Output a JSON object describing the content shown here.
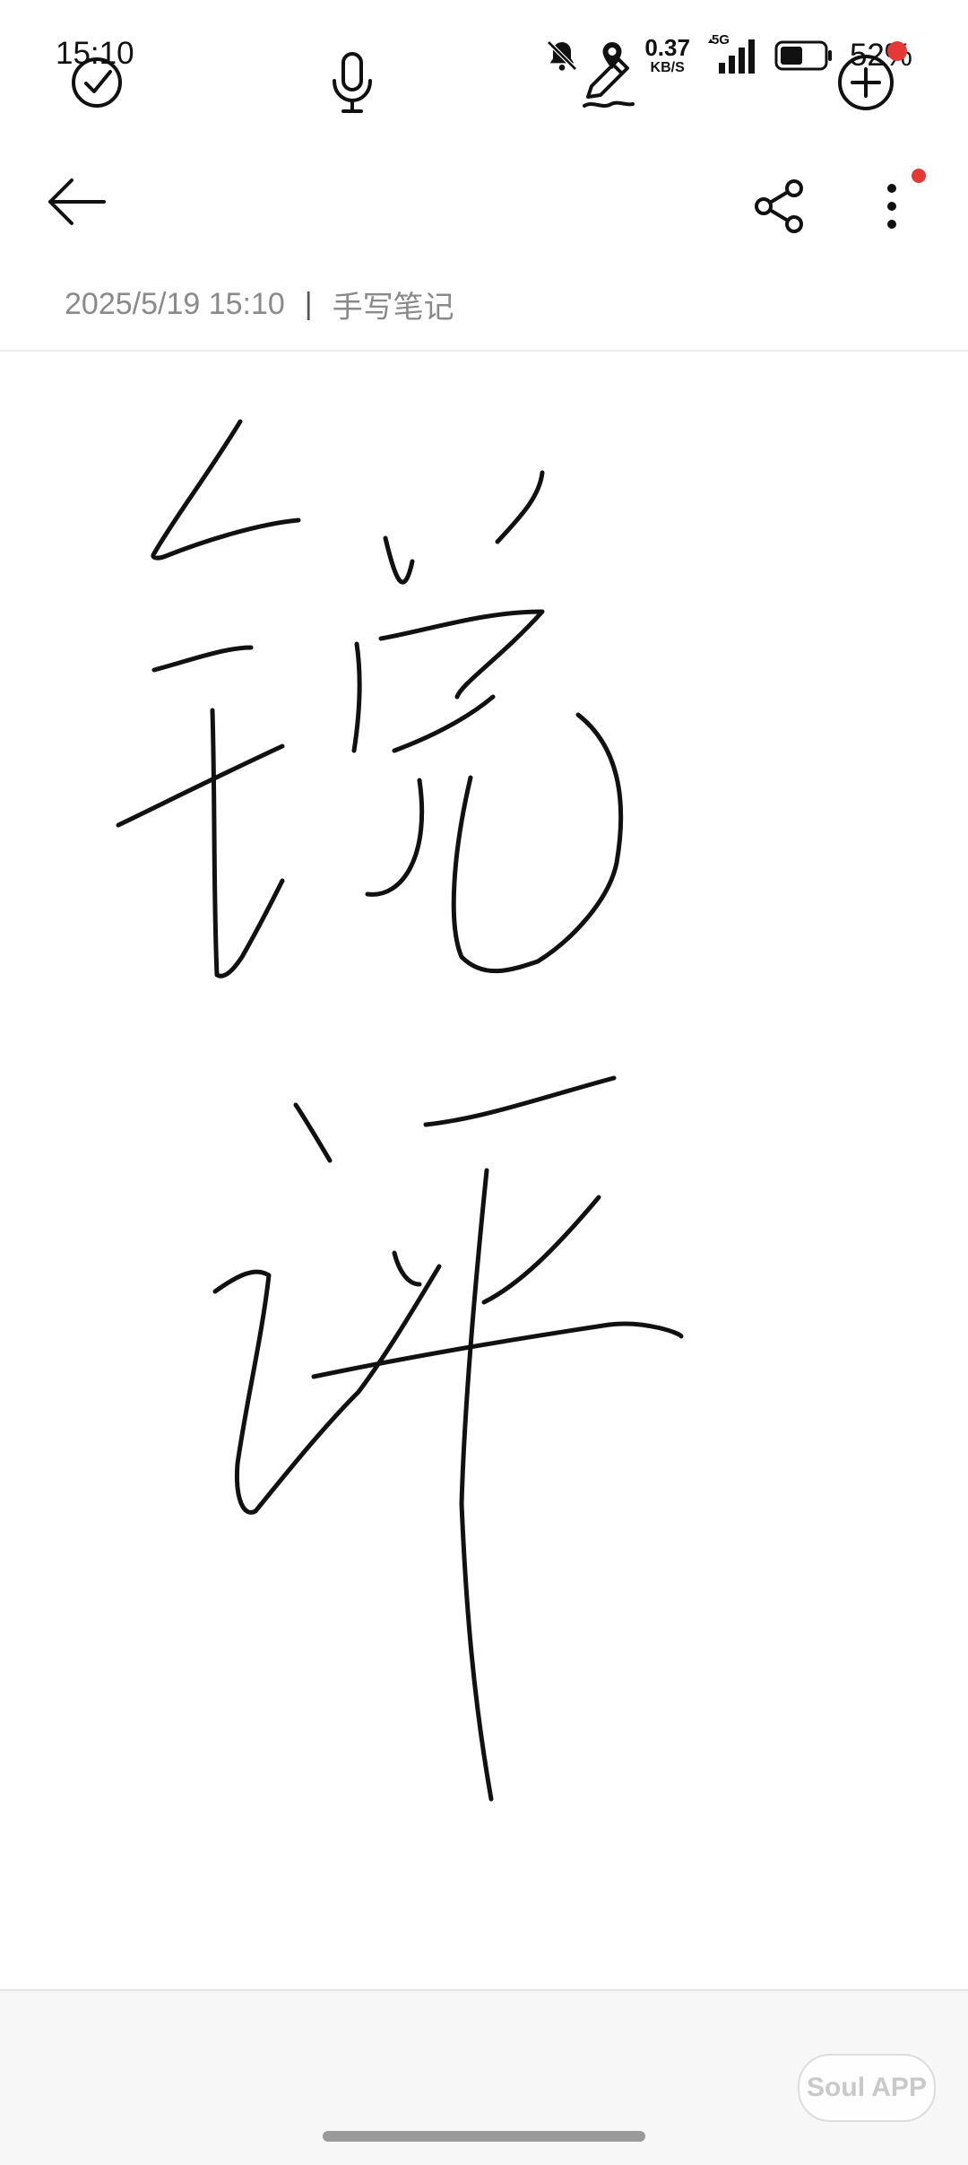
{
  "status_bar": {
    "time": "15:10",
    "net_speed_value": "0.37",
    "net_speed_unit": "KB/S",
    "network_type": "5G",
    "battery_percent": "52%",
    "battery_level": 0.52,
    "icons": [
      "bell-off-icon",
      "location-icon",
      "signal-icon",
      "battery-icon"
    ]
  },
  "header": {
    "back_icon": "arrow-left-icon",
    "share_icon": "share-icon",
    "more_icon": "more-vertical-icon",
    "more_has_badge": true,
    "badge_color": "#e53935"
  },
  "note": {
    "date": "2025/5/19 15:10",
    "separator": "|",
    "category": "手写笔记",
    "handwriting_text": "锐评"
  },
  "toolbar": {
    "items": [
      {
        "name": "checklist",
        "icon": "check-circle-icon"
      },
      {
        "name": "voice",
        "icon": "microphone-icon"
      },
      {
        "name": "handwriting",
        "icon": "pen-icon"
      },
      {
        "name": "add",
        "icon": "plus-circle-icon",
        "has_badge": true
      }
    ]
  },
  "watermark": {
    "text": "Soul APP"
  }
}
